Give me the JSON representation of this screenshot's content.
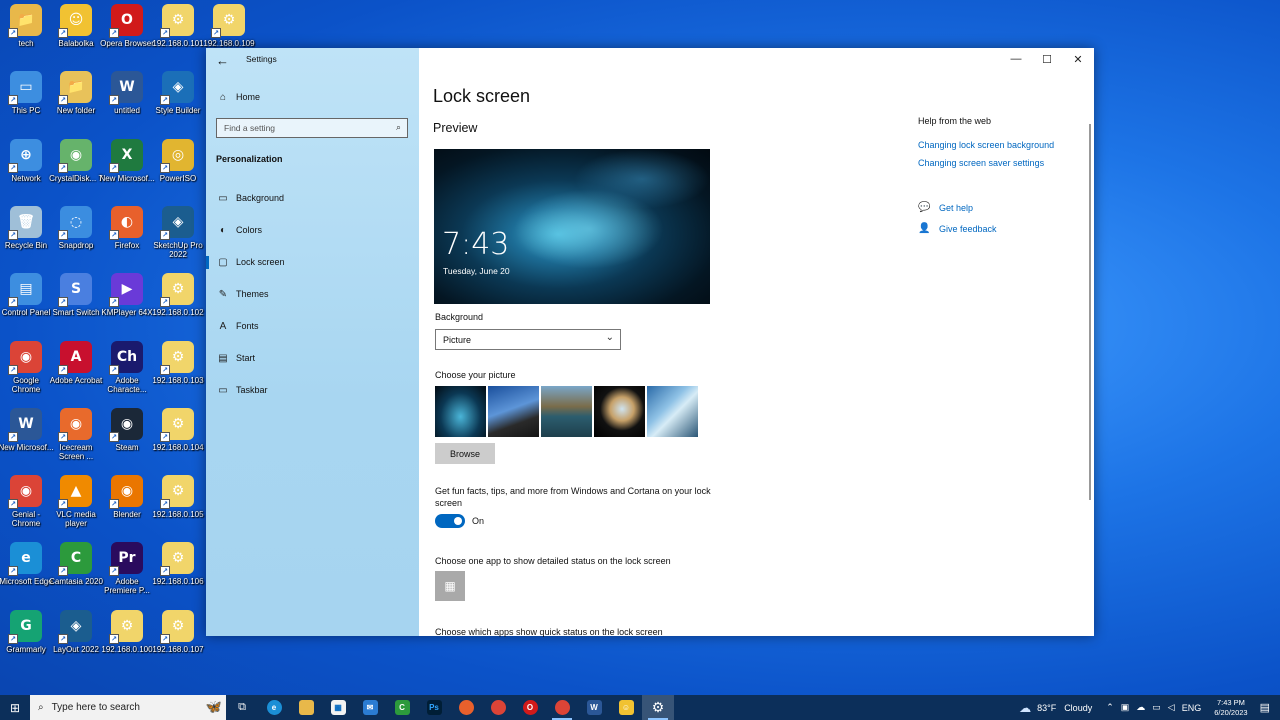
{
  "desktop": {
    "icons": [
      {
        "label": "tech",
        "color": "#e8b84a",
        "glyph": "📁"
      },
      {
        "label": "Balabolka",
        "color": "#f1c232",
        "glyph": "☺"
      },
      {
        "label": "Opera Browser",
        "color": "#d11a1a",
        "glyph": "O"
      },
      {
        "label": "192.168.0.101",
        "color": "#f1d56a",
        "glyph": "⚙"
      },
      {
        "label": "192.168.0.109",
        "color": "#f1d56a",
        "glyph": "⚙"
      },
      {
        "label": "This PC",
        "color": "#3d8ee0",
        "glyph": "▭"
      },
      {
        "label": "New folder",
        "color": "#e8c25a",
        "glyph": "📁"
      },
      {
        "label": "untitled",
        "color": "#2b5797",
        "glyph": "W"
      },
      {
        "label": "Style Builder",
        "color": "#1b6fb8",
        "glyph": "◈"
      },
      {
        "label": "Network",
        "color": "#3d8ee0",
        "glyph": "⊕"
      },
      {
        "label": "CrystalDisk... 7",
        "color": "#66b36b",
        "glyph": "◉"
      },
      {
        "label": "New Microsof...",
        "color": "#1f7a3f",
        "glyph": "X"
      },
      {
        "label": "PowerISO",
        "color": "#e1b530",
        "glyph": "◎"
      },
      {
        "label": "Recycle Bin",
        "color": "#9fbfd8",
        "glyph": "🗑"
      },
      {
        "label": "Snapdrop",
        "color": "#3b8de0",
        "glyph": "◌"
      },
      {
        "label": "Firefox",
        "color": "#e8602c",
        "glyph": "◐"
      },
      {
        "label": "SketchUp Pro 2022",
        "color": "#1b5d8f",
        "glyph": "◈"
      },
      {
        "label": "Control Panel",
        "color": "#3d8ee0",
        "glyph": "▤"
      },
      {
        "label": "Smart Switch",
        "color": "#4a7fe0",
        "glyph": "S"
      },
      {
        "label": "KMPlayer 64X",
        "color": "#6a3ad8",
        "glyph": "▶"
      },
      {
        "label": "192.168.0.102",
        "color": "#f1d56a",
        "glyph": "⚙"
      },
      {
        "label": "Google Chrome",
        "color": "#db4437",
        "glyph": "◉"
      },
      {
        "label": "Adobe Acrobat",
        "color": "#c8102e",
        "glyph": "A"
      },
      {
        "label": "Adobe Characte...",
        "color": "#1a1a6e",
        "glyph": "Ch"
      },
      {
        "label": "192.168.0.103",
        "color": "#f1d56a",
        "glyph": "⚙"
      },
      {
        "label": "New Microsof...",
        "color": "#2b5797",
        "glyph": "W"
      },
      {
        "label": "Icecream Screen ...",
        "color": "#e86a2c",
        "glyph": "◉"
      },
      {
        "label": "Steam",
        "color": "#1b2838",
        "glyph": "◉"
      },
      {
        "label": "192.168.0.104",
        "color": "#f1d56a",
        "glyph": "⚙"
      },
      {
        "label": "Genial - Chrome",
        "color": "#db4437",
        "glyph": "◉"
      },
      {
        "label": "VLC media player",
        "color": "#f08a00",
        "glyph": "▲"
      },
      {
        "label": "Blender",
        "color": "#ea7600",
        "glyph": "◉"
      },
      {
        "label": "192.168.0.105",
        "color": "#f1d56a",
        "glyph": "⚙"
      },
      {
        "label": "Microsoft Edge",
        "color": "#1b8fd6",
        "glyph": "e"
      },
      {
        "label": "Camtasia 2020",
        "color": "#2c9a3c",
        "glyph": "C"
      },
      {
        "label": "Adobe Premiere P...",
        "color": "#2a0b5e",
        "glyph": "Pr"
      },
      {
        "label": "192.168.0.106",
        "color": "#f1d56a",
        "glyph": "⚙"
      },
      {
        "label": "Grammarly",
        "color": "#15a373",
        "glyph": "G"
      },
      {
        "label": "LayOut 2022",
        "color": "#1b5d8f",
        "glyph": "◈"
      },
      {
        "label": "192.168.0.100",
        "color": "#f1d56a",
        "glyph": "⚙"
      },
      {
        "label": "192.168.0.107",
        "color": "#f1d56a",
        "glyph": "⚙"
      }
    ]
  },
  "settings": {
    "app_title": "Settings",
    "nav": {
      "home": "Home",
      "search_placeholder": "Find a setting",
      "section": "Personalization",
      "items": [
        {
          "label": "Background",
          "icon": "▭"
        },
        {
          "label": "Colors",
          "icon": "◐"
        },
        {
          "label": "Lock screen",
          "icon": "▢"
        },
        {
          "label": "Themes",
          "icon": "✎"
        },
        {
          "label": "Fonts",
          "icon": "A"
        },
        {
          "label": "Start",
          "icon": "▤"
        },
        {
          "label": "Taskbar",
          "icon": "▭"
        }
      ],
      "selected_index": 2
    },
    "page": {
      "title": "Lock screen",
      "preview_heading": "Preview",
      "preview_time": "7:43",
      "preview_date": "Tuesday, June 20",
      "background_label": "Background",
      "background_value": "Picture",
      "choose_picture_label": "Choose your picture",
      "browse_label": "Browse",
      "fun_facts_label": "Get fun facts, tips, and more from Windows and Cortana on your lock screen",
      "fun_facts_state": "On",
      "detailed_status_label": "Choose one app to show detailed status on the lock screen",
      "quick_status_label": "Choose which apps show quick status on the lock screen"
    },
    "help": {
      "heading": "Help from the web",
      "links": [
        "Changing lock screen background",
        "Changing screen saver settings"
      ],
      "get_help": "Get help",
      "give_feedback": "Give feedback"
    },
    "accent_color": "#0067c0"
  },
  "taskbar": {
    "search_placeholder": "Type here to search",
    "weather_temp": "83°F",
    "weather_desc": "Cloudy",
    "language": "ENG",
    "time": "7:43 PM",
    "date": "6/20/2023"
  }
}
